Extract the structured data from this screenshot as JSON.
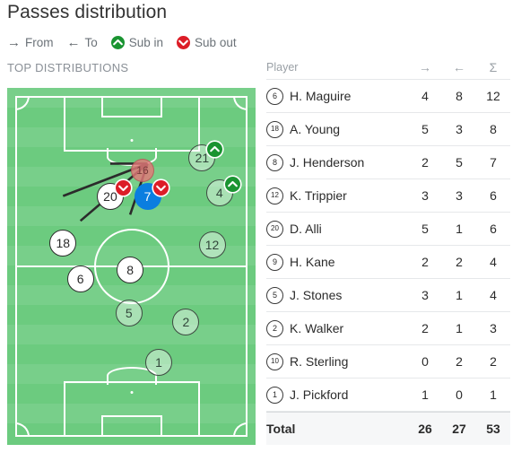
{
  "header": {
    "title": "Passes distribution",
    "section_label": "TOP DISTRIBUTIONS"
  },
  "legend": [
    {
      "icon": "arrow-right-icon",
      "glyph": "→",
      "label": "From",
      "type": "arrow"
    },
    {
      "icon": "arrow-left-icon",
      "glyph": "←",
      "label": "To",
      "type": "arrow"
    },
    {
      "icon": "sub-in-icon",
      "label": "Sub in",
      "type": "in",
      "color": "#1a9431"
    },
    {
      "icon": "sub-out-icon",
      "label": "Sub out",
      "type": "out",
      "color": "#dc1d27"
    }
  ],
  "pitch": {
    "markers": [
      {
        "number": "16",
        "style": "ghost",
        "x": 54.5,
        "y": 23.0,
        "badge": "none"
      },
      {
        "number": "21",
        "style": "dim",
        "x": 78.5,
        "y": 19.5,
        "badge": "in"
      },
      {
        "number": "4",
        "style": "dim",
        "x": 85.5,
        "y": 29.5,
        "badge": "in"
      },
      {
        "number": "12",
        "style": "dim",
        "x": 82.5,
        "y": 44.0,
        "badge": "none"
      },
      {
        "number": "20",
        "style": "active",
        "x": 41.5,
        "y": 30.5,
        "badge": "out"
      },
      {
        "number": "7",
        "style": "sel",
        "x": 56.5,
        "y": 30.5,
        "badge": "out"
      },
      {
        "number": "18",
        "style": "active",
        "x": 22.5,
        "y": 43.5,
        "badge": "none"
      },
      {
        "number": "6",
        "style": "active",
        "x": 29.5,
        "y": 53.5,
        "badge": "none"
      },
      {
        "number": "8",
        "style": "active",
        "x": 49.5,
        "y": 51.0,
        "badge": "none"
      },
      {
        "number": "5",
        "style": "dim",
        "x": 49.0,
        "y": 63.0,
        "badge": "none"
      },
      {
        "number": "2",
        "style": "dim",
        "x": 72.0,
        "y": 65.5,
        "badge": "none"
      },
      {
        "number": "1",
        "style": "dim",
        "x": 61.0,
        "y": 77.0,
        "badge": "none"
      }
    ],
    "links": [
      {
        "from": [
          56.5,
          30.5
        ],
        "to": [
          22.5,
          43.5
        ]
      },
      {
        "from": [
          56.5,
          30.5
        ],
        "to": [
          29.5,
          53.5
        ]
      },
      {
        "from": [
          56.5,
          30.5
        ],
        "to": [
          49.5,
          51.0
        ]
      },
      {
        "from": [
          56.5,
          30.5
        ],
        "to": [
          41.5,
          30.5
        ]
      }
    ]
  },
  "table": {
    "columns": [
      "Player",
      "→",
      "←",
      "Σ"
    ],
    "rows": [
      {
        "num": "6",
        "name": "H. Maguire",
        "from": "4",
        "to": "8",
        "total": "12"
      },
      {
        "num": "18",
        "name": "A. Young",
        "from": "5",
        "to": "3",
        "total": "8"
      },
      {
        "num": "8",
        "name": "J. Henderson",
        "from": "2",
        "to": "5",
        "total": "7"
      },
      {
        "num": "12",
        "name": "K. Trippier",
        "from": "3",
        "to": "3",
        "total": "6"
      },
      {
        "num": "20",
        "name": "D. Alli",
        "from": "5",
        "to": "1",
        "total": "6"
      },
      {
        "num": "9",
        "name": "H. Kane",
        "from": "2",
        "to": "2",
        "total": "4"
      },
      {
        "num": "5",
        "name": "J. Stones",
        "from": "3",
        "to": "1",
        "total": "4"
      },
      {
        "num": "2",
        "name": "K. Walker",
        "from": "2",
        "to": "1",
        "total": "3"
      },
      {
        "num": "10",
        "name": "R. Sterling",
        "from": "0",
        "to": "2",
        "total": "2"
      },
      {
        "num": "1",
        "name": "J. Pickford",
        "from": "1",
        "to": "0",
        "total": "1"
      }
    ],
    "total_row": {
      "label": "Total",
      "from": "26",
      "to": "27",
      "total": "53"
    }
  }
}
